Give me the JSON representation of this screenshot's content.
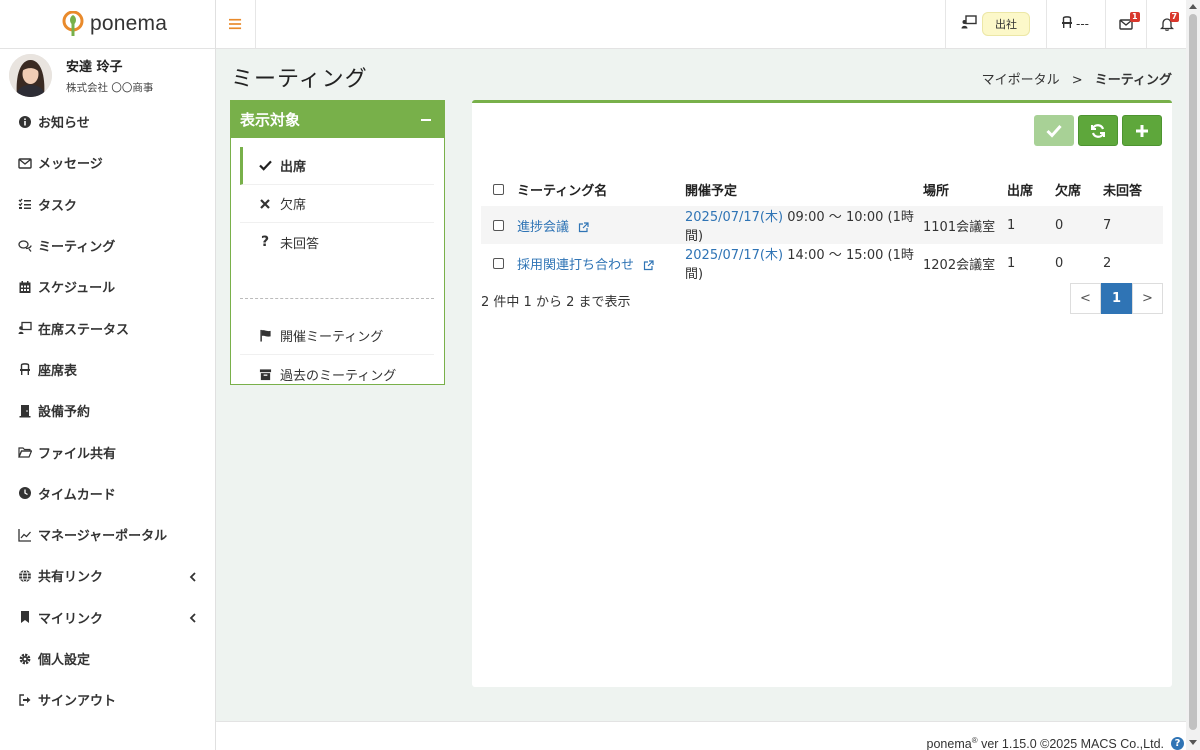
{
  "app": {
    "logo_text": "ponema"
  },
  "user": {
    "name": "安達 玲子",
    "company": "株式会社 〇〇商事"
  },
  "sidebar": {
    "items": [
      {
        "label": "お知らせ",
        "icon": "info-icon"
      },
      {
        "label": "メッセージ",
        "icon": "envelope-icon"
      },
      {
        "label": "タスク",
        "icon": "tasks-icon"
      },
      {
        "label": "ミーティング",
        "icon": "comments-icon"
      },
      {
        "label": "スケジュール",
        "icon": "calendar-icon"
      },
      {
        "label": "在席ステータス",
        "icon": "presence-icon"
      },
      {
        "label": "座席表",
        "icon": "chair-icon"
      },
      {
        "label": "設備予約",
        "icon": "door-icon"
      },
      {
        "label": "ファイル共有",
        "icon": "folder-icon"
      },
      {
        "label": "タイムカード",
        "icon": "clock-icon"
      },
      {
        "label": "マネージャーポータル",
        "icon": "chart-icon"
      },
      {
        "label": "共有リンク",
        "icon": "globe-icon"
      },
      {
        "label": "マイリンク",
        "icon": "bookmark-icon"
      },
      {
        "label": "個人設定",
        "icon": "gear-icon"
      },
      {
        "label": "サインアウト",
        "icon": "signout-icon"
      }
    ]
  },
  "topbar": {
    "status_label": "出社",
    "seat_label": "---",
    "mail_count": "1",
    "notification_count": "7"
  },
  "page": {
    "title": "ミーティング",
    "breadcrumb": {
      "parent": "マイポータル",
      "separator": ">",
      "current": "ミーティング"
    }
  },
  "filter": {
    "title": "表示対象",
    "items": [
      "出席",
      "欠席",
      "未回答"
    ],
    "links": [
      "開催ミーティング",
      "過去のミーティング"
    ]
  },
  "table": {
    "headers": [
      "ミーティング名",
      "開催予定",
      "場所",
      "出席",
      "欠席",
      "未回答"
    ],
    "rows": [
      {
        "name": "進捗会議",
        "date": "2025/07/17(木)",
        "time": " 09:00 〜 10:00 (1時間)",
        "place": "1101会議室",
        "attend": "1",
        "absent": "0",
        "unanswered": "7"
      },
      {
        "name": "採用関連打ち合わせ",
        "date": "2025/07/17(木)",
        "time": " 14:00 〜 15:00 (1時間)",
        "place": "1202会議室",
        "attend": "1",
        "absent": "0",
        "unanswered": "2"
      }
    ],
    "summary": "2 件中 1 から 2 まで表示",
    "pager": {
      "prev": "<",
      "current": "1",
      "next": ">"
    }
  },
  "footer": {
    "brand": "ponema",
    "reg": "®",
    "text": " ver 1.15.0 ©2025 MACS Co.,Ltd.",
    "help": "?"
  },
  "colors": {
    "accent_green": "#78b04a",
    "link_blue": "#2f74b5",
    "badge_red": "#d9372c"
  }
}
